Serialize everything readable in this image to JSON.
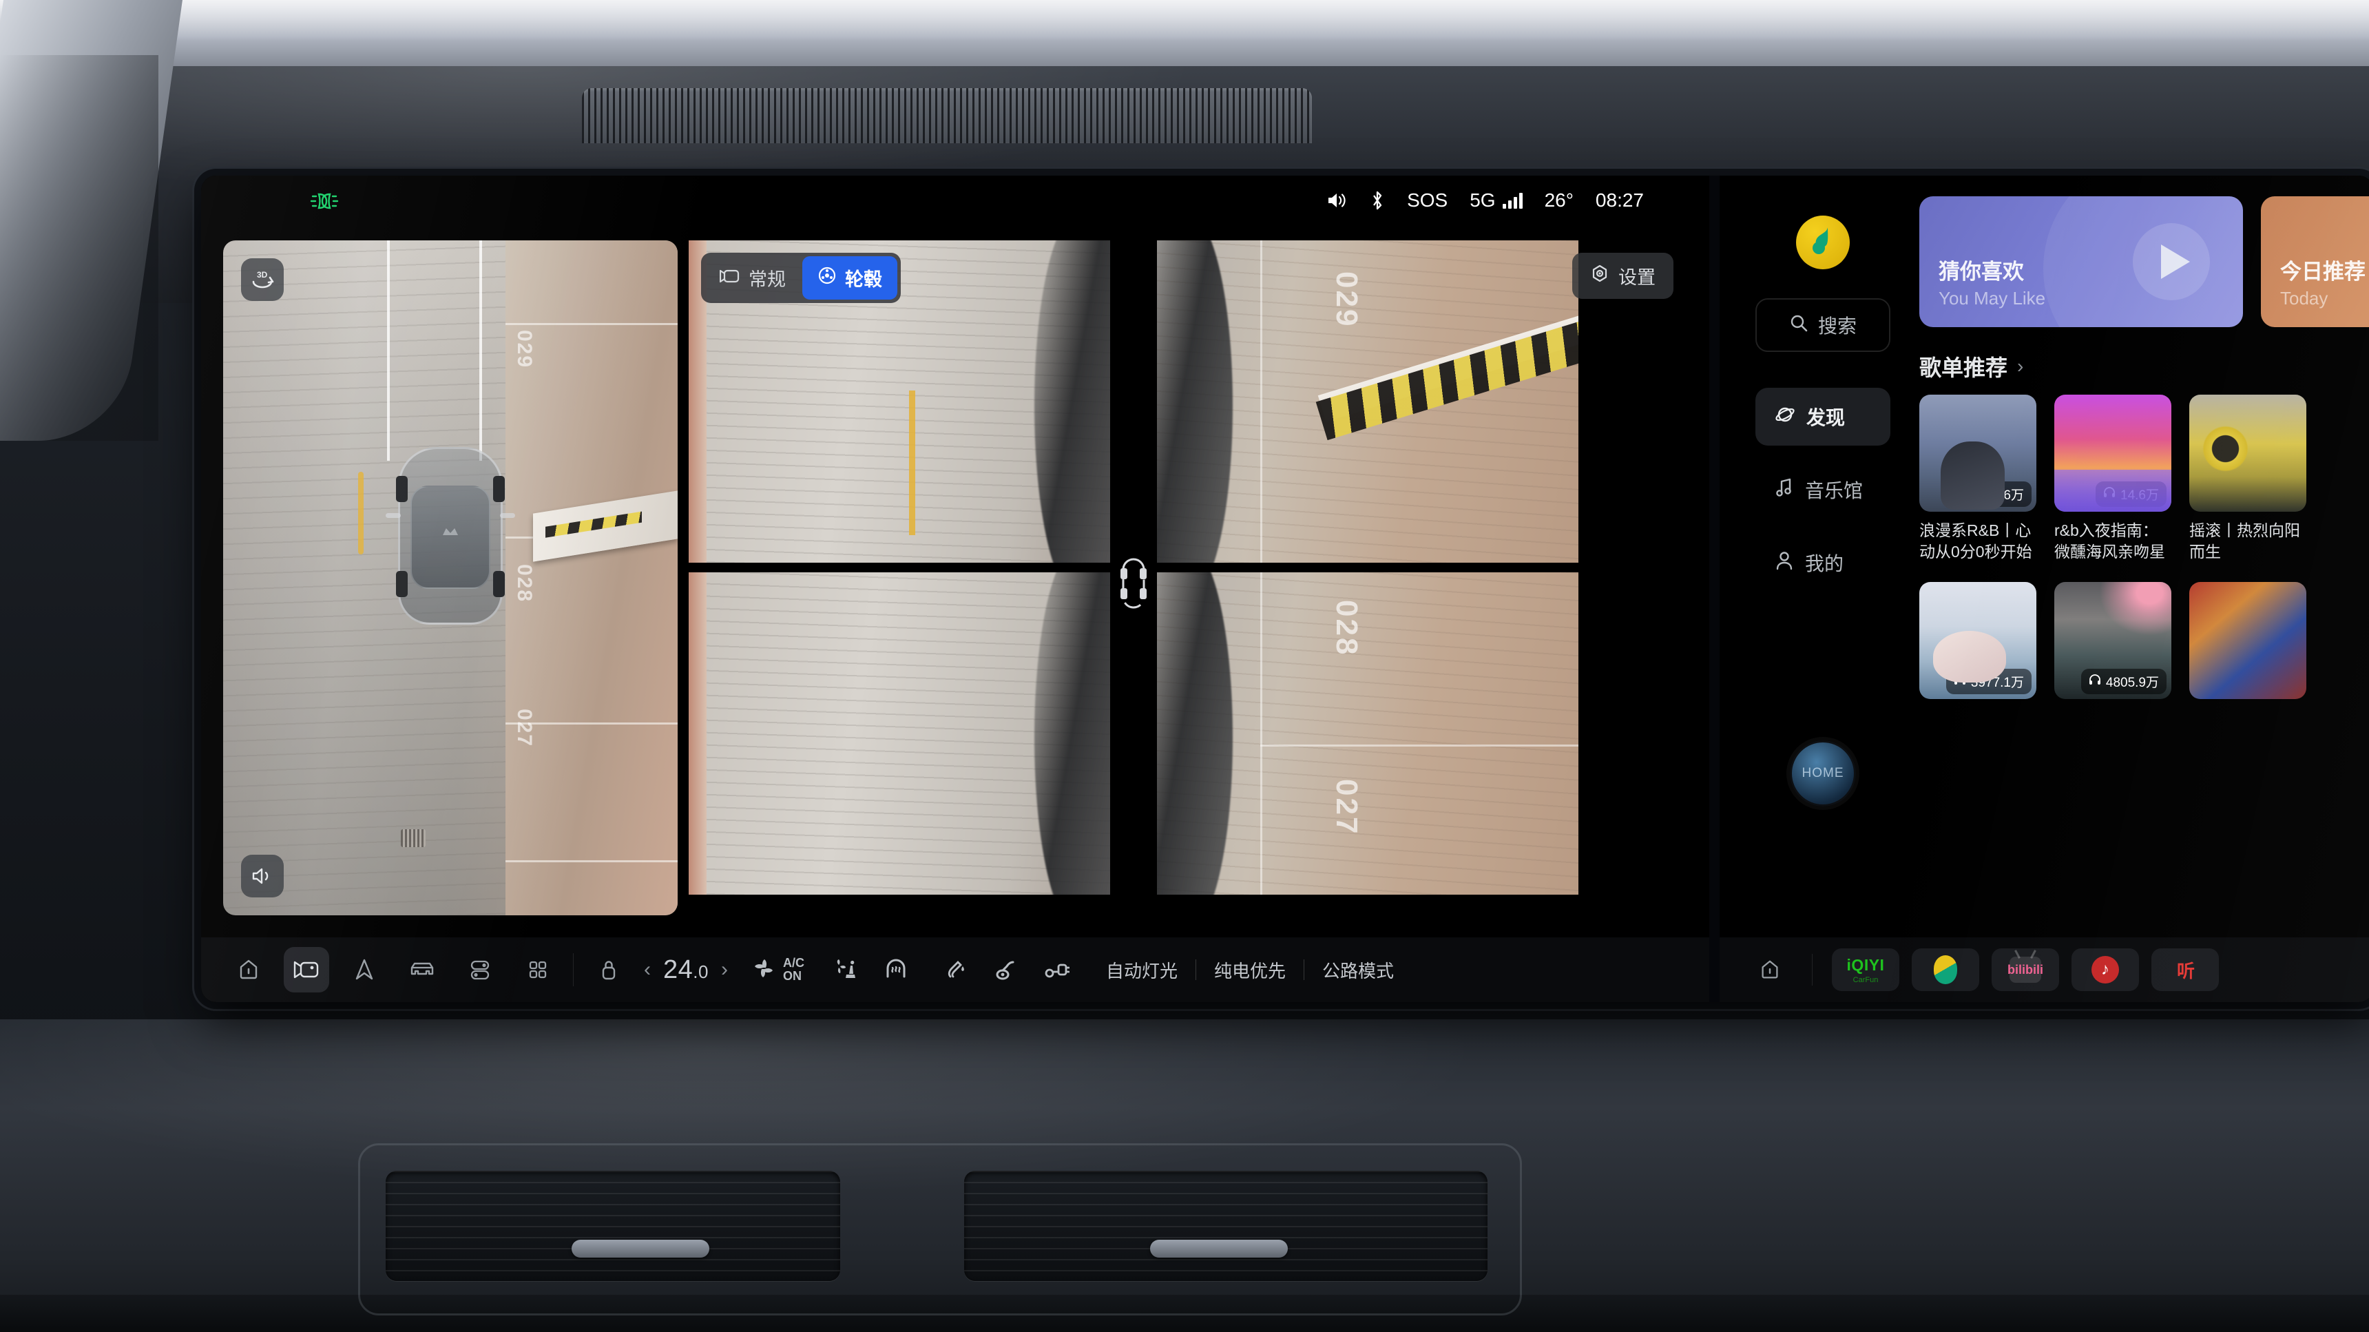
{
  "statusbar": {
    "headlight_icon": "headlight-indicator-icon",
    "volume_icon": "volume-icon",
    "bluetooth_icon": "bluetooth-icon",
    "sos_label": "SOS",
    "network_label": "5G",
    "temperature": "26°",
    "time": "08:27"
  },
  "camera": {
    "tabs": [
      {
        "label": "常规",
        "icon": "camera-icon",
        "active": false
      },
      {
        "label": "轮毂",
        "icon": "wheel-hub-icon",
        "active": true
      }
    ],
    "settings_label": "设置",
    "settings_icon": "gear-icon",
    "birdseye": {
      "view_3d_label": "3D",
      "sound_icon": "speaker-icon",
      "stall_numbers": [
        "029",
        "028",
        "027"
      ]
    },
    "quad_stall_numbers": [
      "029",
      "028",
      "027"
    ],
    "center_indicator": "car-wheels-indicator"
  },
  "controlbar": {
    "nav_icons": [
      {
        "name": "home-icon",
        "active": false
      },
      {
        "name": "camera-icon",
        "active": true
      },
      {
        "name": "navigation-icon",
        "active": false
      },
      {
        "name": "car-icon",
        "active": false
      },
      {
        "name": "toggles-icon",
        "active": false
      },
      {
        "name": "apps-grid-icon",
        "active": false
      }
    ],
    "lock_icon": "lock-icon",
    "temp_prev": "‹",
    "temp_value": "24",
    "temp_decimal": ".0",
    "temp_next": "›",
    "ac_line1": "A/C",
    "ac_line2": "ON",
    "climate_icons": [
      "fan-icon",
      "seat-airflow-icon",
      "seat-heater-icon"
    ],
    "vehicle_icons": [
      "fuel-icon",
      "oil-icon",
      "charging-plug-icon"
    ],
    "modes": [
      "自动灯光",
      "纯电优先",
      "公路模式"
    ]
  },
  "music": {
    "app_logo": "qq-music-logo",
    "search_placeholder": "搜索",
    "search_icon": "search-icon",
    "nav": [
      {
        "label": "发现",
        "icon": "discover-icon",
        "active": true
      },
      {
        "label": "音乐馆",
        "icon": "music-note-icon",
        "active": false
      },
      {
        "label": "我的",
        "icon": "user-icon",
        "active": false
      }
    ],
    "now_playing_label": "HOME",
    "banners": [
      {
        "title": "猜你喜欢",
        "subtitle": "You May Like",
        "play_icon": "play-icon",
        "theme": "purple"
      },
      {
        "title": "今日推荐",
        "subtitle": "Today",
        "play_icon": "play-icon",
        "theme": "orange"
      }
    ],
    "section_title": "歌单推荐",
    "section_chevron": "›",
    "playlists_row1": [
      {
        "title": "浪漫系R&B丨心动从0分0秒开始",
        "plays": "121.6万",
        "cover": "cv1"
      },
      {
        "title": "r&b入夜指南：微醺海风亲吻星滩",
        "plays": "14.6万",
        "cover": "cv2"
      },
      {
        "title": "摇滚丨热烈向阳而生",
        "plays": "",
        "cover": "cv3"
      }
    ],
    "playlists_row2": [
      {
        "title": "",
        "plays": "3977.1万",
        "cover": "cv4"
      },
      {
        "title": "",
        "plays": "4805.9万",
        "cover": "cv5"
      },
      {
        "title": "",
        "plays": "",
        "cover": "cv6"
      }
    ],
    "plays_icon": "headphones-icon",
    "dock": {
      "home_icon": "home-icon",
      "apps": [
        {
          "name": "iqiyi-app",
          "label": "iQIYI",
          "sublabel": "CarFun"
        },
        {
          "name": "qq-music-app",
          "label": ""
        },
        {
          "name": "bilibili-app",
          "label": "bilibili"
        },
        {
          "name": "netease-music-app",
          "label": ""
        },
        {
          "name": "kugou-music-app",
          "label": "听"
        }
      ]
    }
  },
  "colors": {
    "accent_blue": "#2563eb",
    "indicator_green": "#19d36a",
    "panel_black": "#000000",
    "banner_purple": "#6b6fc4"
  }
}
